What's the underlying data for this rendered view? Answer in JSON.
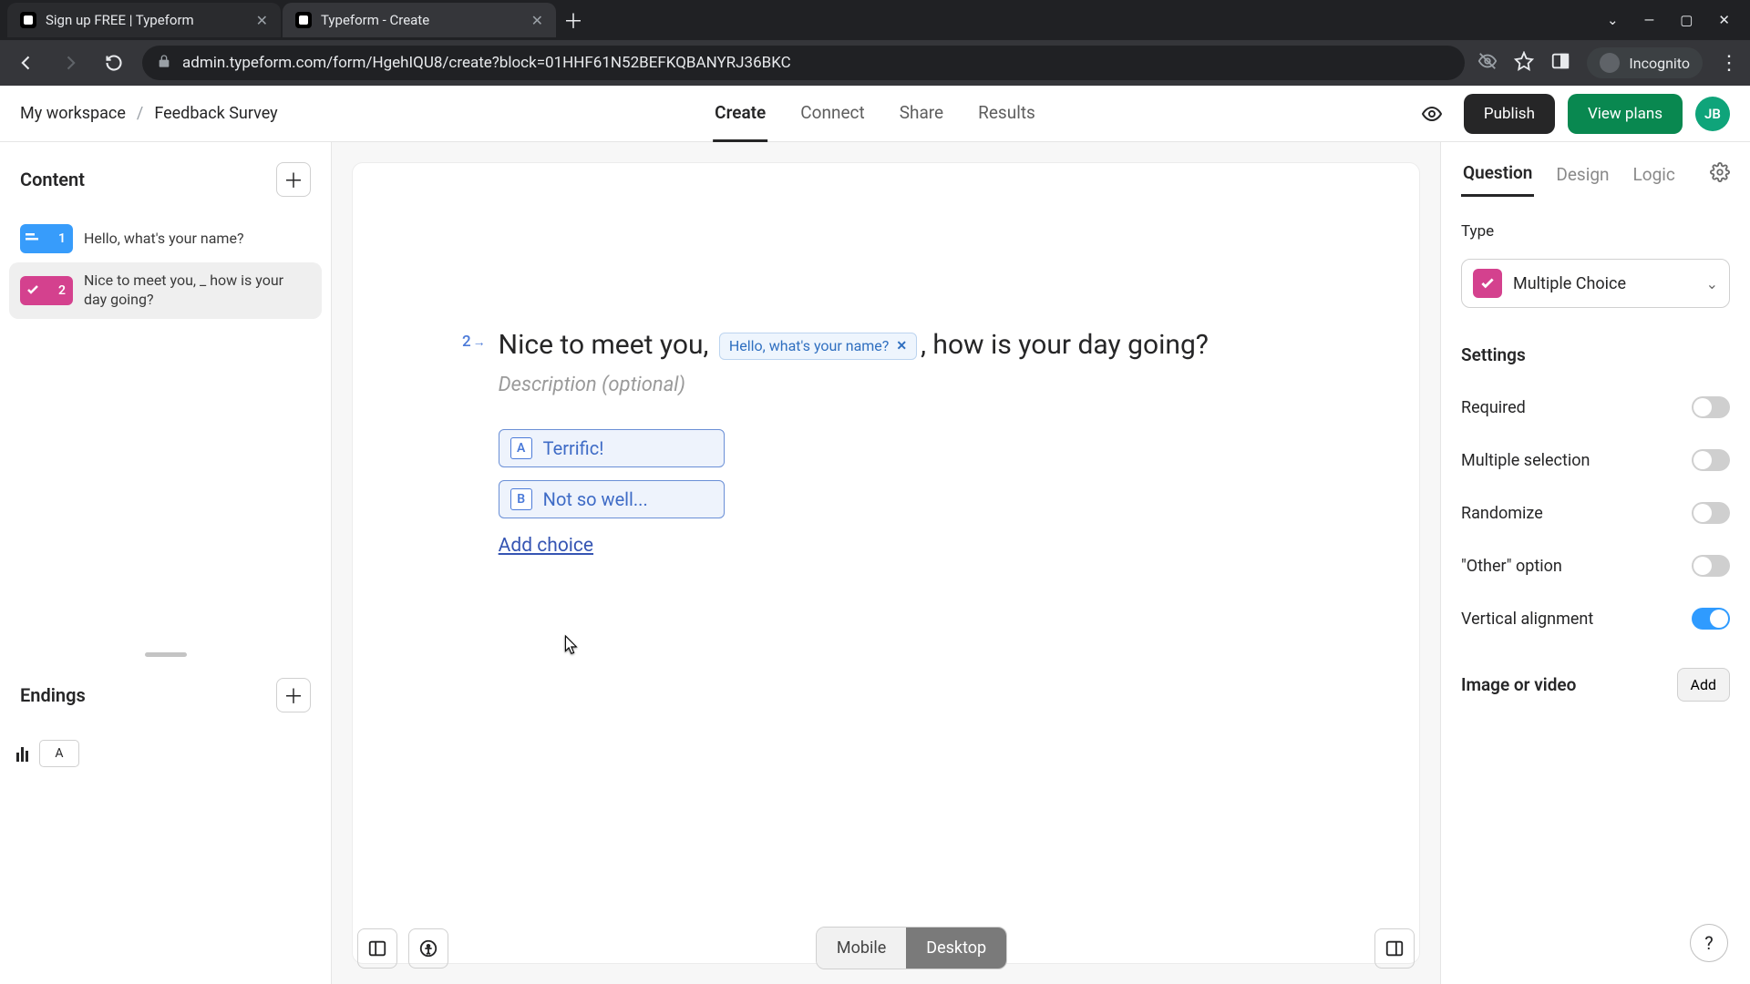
{
  "browser": {
    "tabs": [
      {
        "title": "Sign up FREE | Typeform"
      },
      {
        "title": "Typeform - Create"
      }
    ],
    "url": "admin.typeform.com/form/HgehIQU8/create?block=01HHF61N52BEFKQBANYRJ36BKC",
    "incognito_label": "Incognito",
    "win": {
      "chevron": "⌄",
      "min": "—",
      "max": "▢",
      "close": "✕"
    }
  },
  "header": {
    "workspace": "My workspace",
    "form_name": "Feedback Survey",
    "tabs": {
      "create": "Create",
      "connect": "Connect",
      "share": "Share",
      "results": "Results"
    },
    "publish": "Publish",
    "view_plans": "View plans",
    "avatar_initials": "JB"
  },
  "sidebar": {
    "content_title": "Content",
    "items": [
      {
        "num": "1",
        "label": "Hello, what's your name?",
        "color": "blue",
        "icon": "short-text"
      },
      {
        "num": "2",
        "label": "Nice to meet you, _ how is your day going?",
        "color": "pink",
        "icon": "multiple-choice"
      }
    ],
    "endings_title": "Endings",
    "endings": [
      {
        "key": "A"
      }
    ]
  },
  "canvas": {
    "q_index": "2",
    "arrow": "→",
    "title_before": "Nice to meet you, ",
    "recall_chip": "Hello, what's your name?",
    "title_after": ", how is your day going?",
    "description_placeholder": "Description (optional)",
    "choices": [
      {
        "key": "A",
        "label": "Terrific!"
      },
      {
        "key": "B",
        "label": "Not so well..."
      }
    ],
    "add_choice": "Add choice",
    "device": {
      "mobile": "Mobile",
      "desktop": "Desktop"
    }
  },
  "rpanel": {
    "tabs": {
      "question": "Question",
      "design": "Design",
      "logic": "Logic"
    },
    "type_label": "Type",
    "type_value": "Multiple Choice",
    "settings_title": "Settings",
    "settings": {
      "required": "Required",
      "multiple_selection": "Multiple selection",
      "randomize": "Randomize",
      "other_option": "\"Other\" option",
      "vertical_alignment": "Vertical alignment"
    },
    "toggles": {
      "required": false,
      "multiple_selection": false,
      "randomize": false,
      "other_option": false,
      "vertical_alignment": true
    },
    "media_label": "Image or video",
    "media_add": "Add"
  },
  "help": "?"
}
